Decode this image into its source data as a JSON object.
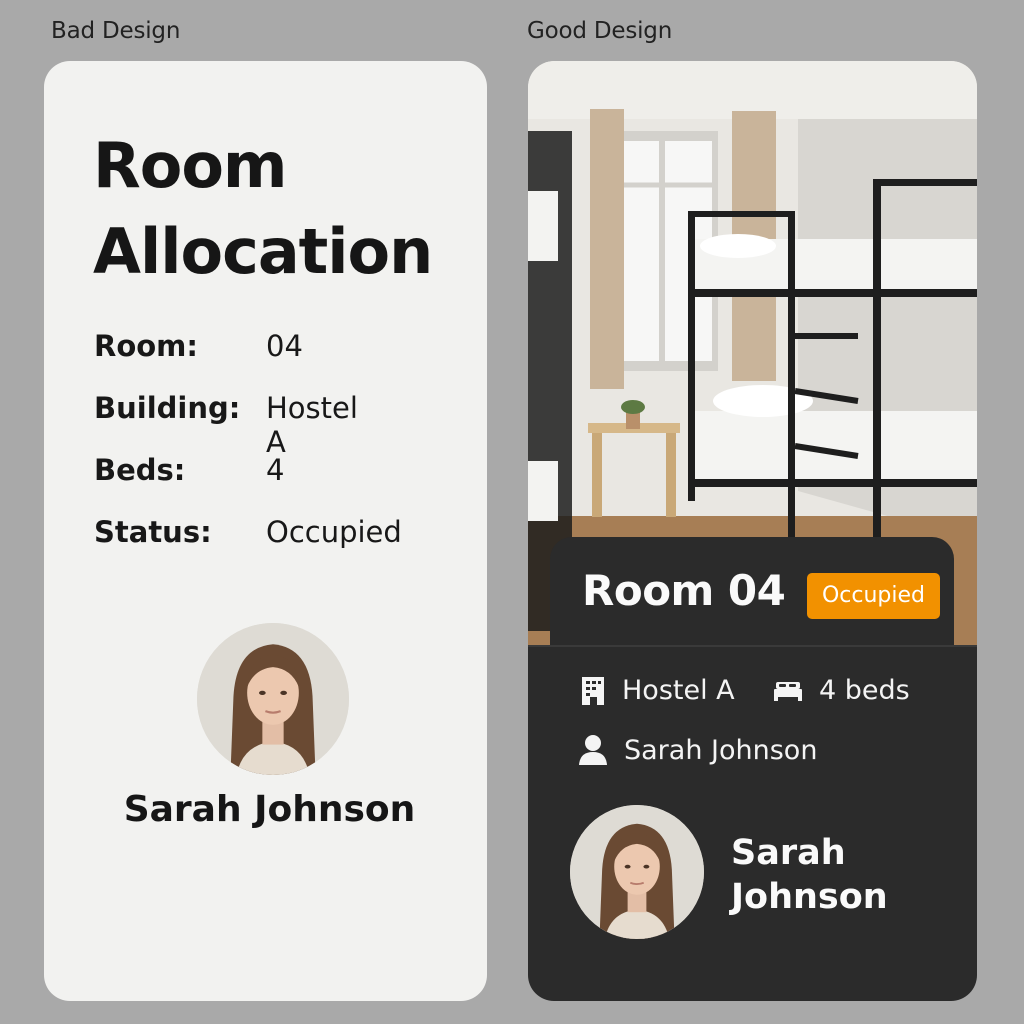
{
  "labels": {
    "bad": "Bad Design",
    "good": "Good Design"
  },
  "bad_card": {
    "title_line1": "Room",
    "title_line2": "Allocation",
    "rows": [
      {
        "key": "Room:",
        "value": "04"
      },
      {
        "key": "Building:",
        "value": "Hostel A"
      },
      {
        "key": "Beds:",
        "value": "4"
      },
      {
        "key": "Status:",
        "value": "Occupied"
      }
    ],
    "occupant_name": "Sarah Johnson"
  },
  "good_card": {
    "title": "Room 04",
    "status": "Occupied",
    "status_color": "#f29100",
    "building": "Hostel A",
    "building_icon": "building-icon",
    "beds": "4 beds",
    "beds_icon": "bed-icon",
    "occupant": "Sarah Johnson",
    "occupant_icon": "user-icon",
    "name_line1": "Sarah",
    "name_line2": "Johnson"
  },
  "colors": {
    "page_bg": "#a9a9a9",
    "bad_card_bg": "#f2f2f0",
    "good_card_bg": "#2b2b2b",
    "accent": "#f29100"
  }
}
